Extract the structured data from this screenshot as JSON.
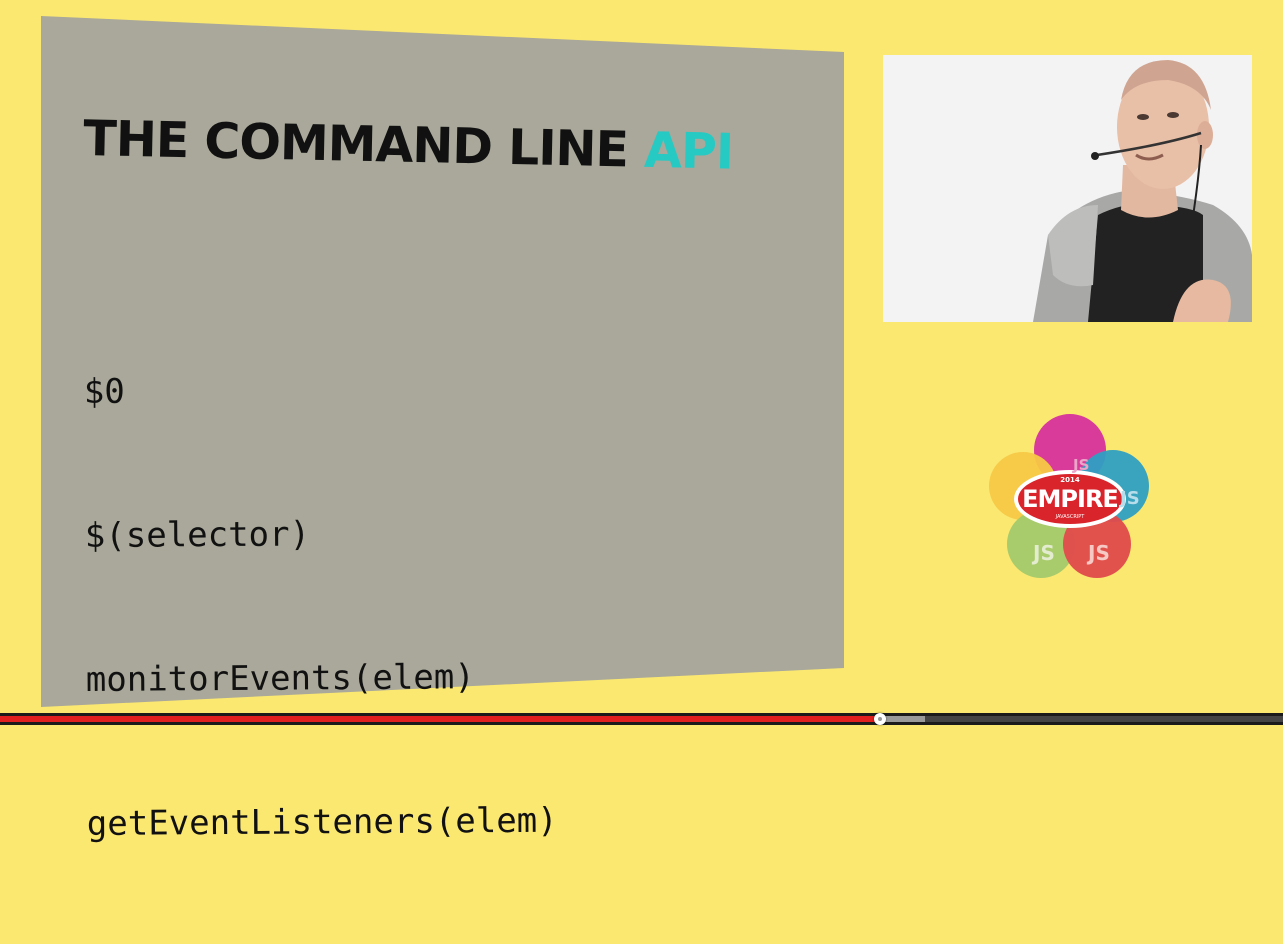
{
  "slide": {
    "title_main": "THE COMMAND LINE ",
    "title_accent": "API",
    "code_lines": [
      "$0",
      "$(selector)",
      "monitorEvents(elem)",
      "getEventListeners(elem)"
    ]
  },
  "logo": {
    "year": "2014",
    "name": "EMPIRE",
    "subtitle": "JAVASCRIPT",
    "petal_labels": [
      "JS",
      "JS",
      "JS",
      "JS"
    ]
  },
  "player": {
    "progress_fraction": 0.686,
    "buffered_fraction": 0.035
  },
  "colors": {
    "background": "#fbe870",
    "slide": "#a9a89a",
    "accent": "#27c9c3",
    "played": "#e01f1f",
    "logo_red": "#d9242c"
  }
}
